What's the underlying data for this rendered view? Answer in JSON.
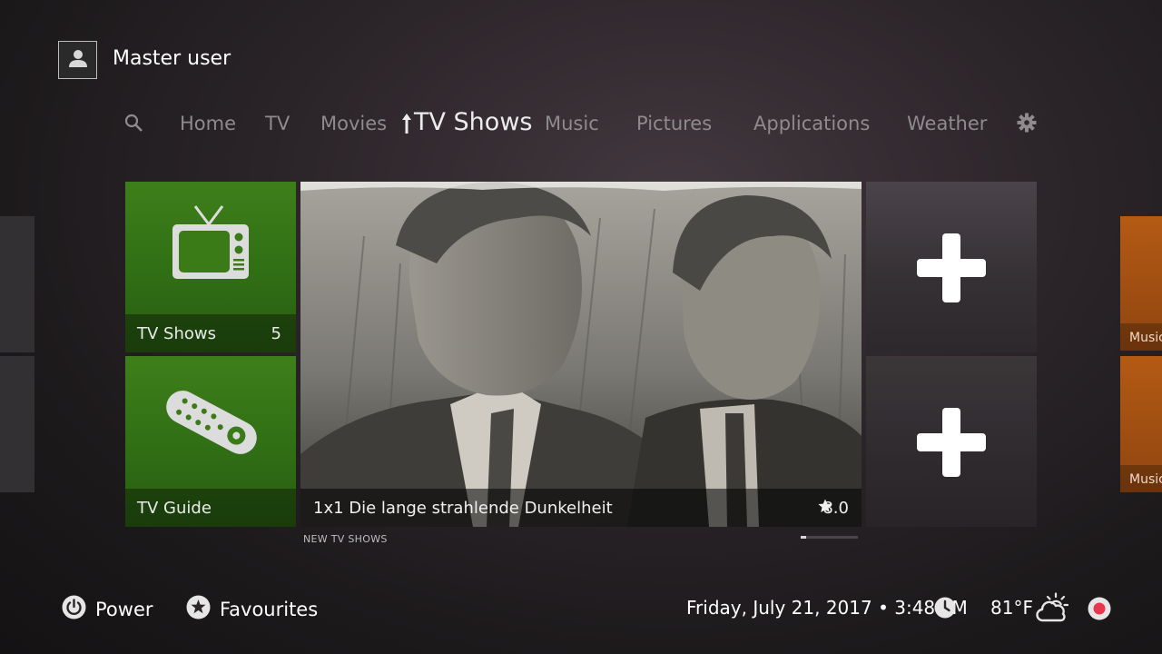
{
  "user": {
    "name": "Master user",
    "avatar_icon": "user-icon"
  },
  "nav": {
    "search_icon": "search-icon",
    "items": [
      {
        "label": "Home"
      },
      {
        "label": "TV"
      },
      {
        "label": "Movies"
      },
      {
        "label": "TV Shows",
        "active": true
      },
      {
        "label": "Music"
      },
      {
        "label": "Pictures"
      },
      {
        "label": "Applications"
      },
      {
        "label": "Weather"
      }
    ],
    "settings_icon": "gear-icon"
  },
  "tiles": {
    "tv_shows": {
      "label": "TV Shows",
      "count": "5",
      "icon": "tv-icon"
    },
    "tv_guide": {
      "label": "TV Guide",
      "icon": "remote-icon"
    },
    "add_top": {
      "icon": "plus-icon"
    },
    "add_bottom": {
      "icon": "plus-icon"
    }
  },
  "featured": {
    "title": "1x1 Die lange strahlende Dunkelheit",
    "rating": "8.0",
    "section_label": "NEW TV SHOWS"
  },
  "edge_right": {
    "top_label": "Music",
    "bottom_label": "Music"
  },
  "bottom_bar": {
    "power_label": "Power",
    "favourites_label": "Favourites",
    "datetime": "Friday, July 21, 2017 • 3:48 PM",
    "temperature": "81°F",
    "weather_icon": "partly-cloudy-icon",
    "record_icon": "record-icon",
    "clock_icon": "clock-icon"
  },
  "colors": {
    "tile_green": "#3e7f1a",
    "edge_orange": "#b45a14",
    "record_red": "#e8384d"
  }
}
